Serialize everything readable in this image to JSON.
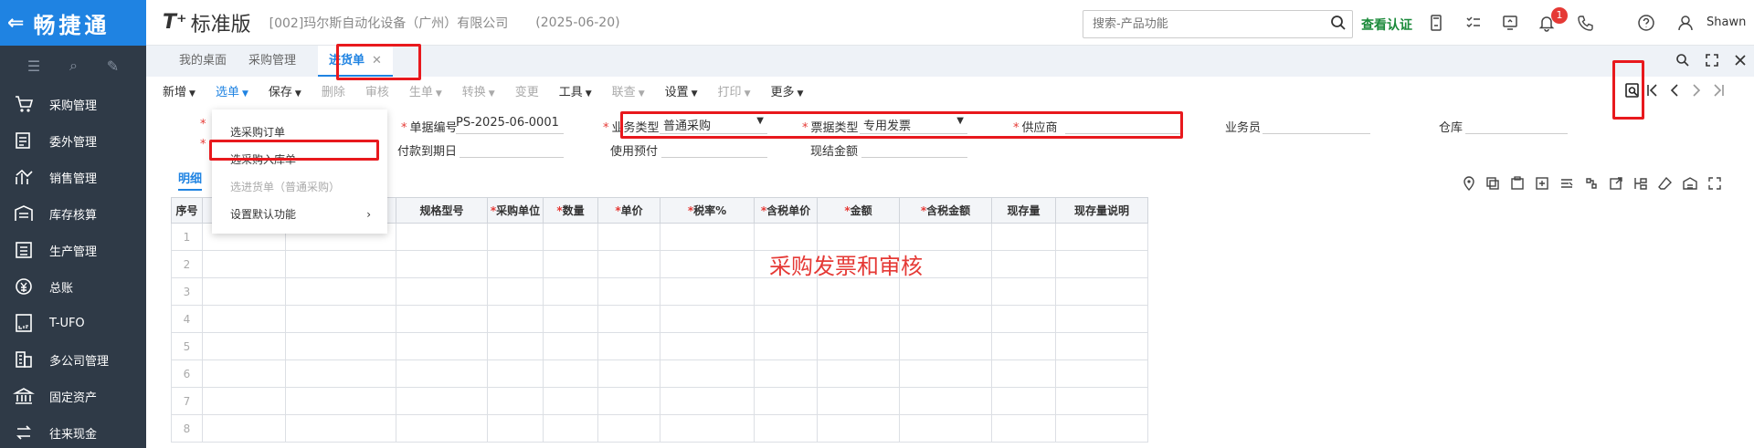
{
  "sidebar": {
    "logo": "畅捷通",
    "items": [
      {
        "label": "采购管理",
        "icon": "purchase-icon"
      },
      {
        "label": "委外管理",
        "icon": "outsource-icon"
      },
      {
        "label": "销售管理",
        "icon": "sales-icon"
      },
      {
        "label": "库存核算",
        "icon": "inventory-icon"
      },
      {
        "label": "生产管理",
        "icon": "production-icon"
      },
      {
        "label": "总账",
        "icon": "ledger-icon"
      },
      {
        "label": "T-UFO",
        "icon": "ufo-icon"
      },
      {
        "label": "多公司管理",
        "icon": "multi-company-icon"
      },
      {
        "label": "固定资产",
        "icon": "fixed-asset-icon"
      },
      {
        "label": "往来现金",
        "icon": "cash-icon"
      }
    ]
  },
  "header": {
    "brand": "T⁺",
    "brand_suffix": "标准版",
    "company": "[002]玛尔斯自动化设备（广州）有限公司",
    "date": "(2025-06-20)",
    "search_placeholder": "搜索-产品功能",
    "verify": "查看认证",
    "notification_count": "1",
    "user": "Shawn"
  },
  "tabs": [
    {
      "label": "我的桌面"
    },
    {
      "label": "采购管理"
    },
    {
      "label": "进货单",
      "close": "✕"
    }
  ],
  "toolbar": {
    "buttons": [
      {
        "label": "新增",
        "caret": true
      },
      {
        "label": "选单",
        "caret": true
      },
      {
        "label": "保存",
        "caret": true
      },
      {
        "label": "删除"
      },
      {
        "label": "审核"
      },
      {
        "label": "生单",
        "caret": true
      },
      {
        "label": "转换",
        "caret": true
      },
      {
        "label": "变更"
      },
      {
        "label": "工具",
        "caret": true
      },
      {
        "label": "联查",
        "caret": true
      },
      {
        "label": "设置",
        "caret": true
      },
      {
        "label": "打印",
        "caret": true
      },
      {
        "label": "更多",
        "caret": true
      }
    ]
  },
  "dropdown": {
    "items": [
      {
        "label": "选采购订单"
      },
      {
        "label": "选采购入库单"
      },
      {
        "label": "选进货单（普通采购）"
      },
      {
        "label": "设置默认功能"
      }
    ]
  },
  "form": {
    "doc_no_label": "单据编号",
    "doc_no": "PS-2025-06-0001",
    "biz_type_label": "业务类型",
    "biz_type": "普通采购",
    "invoice_type_label": "票据类型",
    "invoice_type": "专用发票",
    "supplier_label": "供应商",
    "salesman_label": "业务员",
    "warehouse_label": "仓库",
    "due_date_label": "付款到期日",
    "prepay_label": "使用预付",
    "cash_label": "现结金额"
  },
  "detail_tab": "明细",
  "table": {
    "headers": [
      "序号",
      "",
      "",
      "规格型号",
      "采购单位",
      "数量",
      "单价",
      "税率%",
      "含税单价",
      "金额",
      "含税金额",
      "现存量",
      "现存量说明"
    ],
    "rows": [
      "1",
      "2",
      "3",
      "4",
      "5",
      "6",
      "7",
      "8"
    ]
  },
  "annotation": "采购发票和审核"
}
